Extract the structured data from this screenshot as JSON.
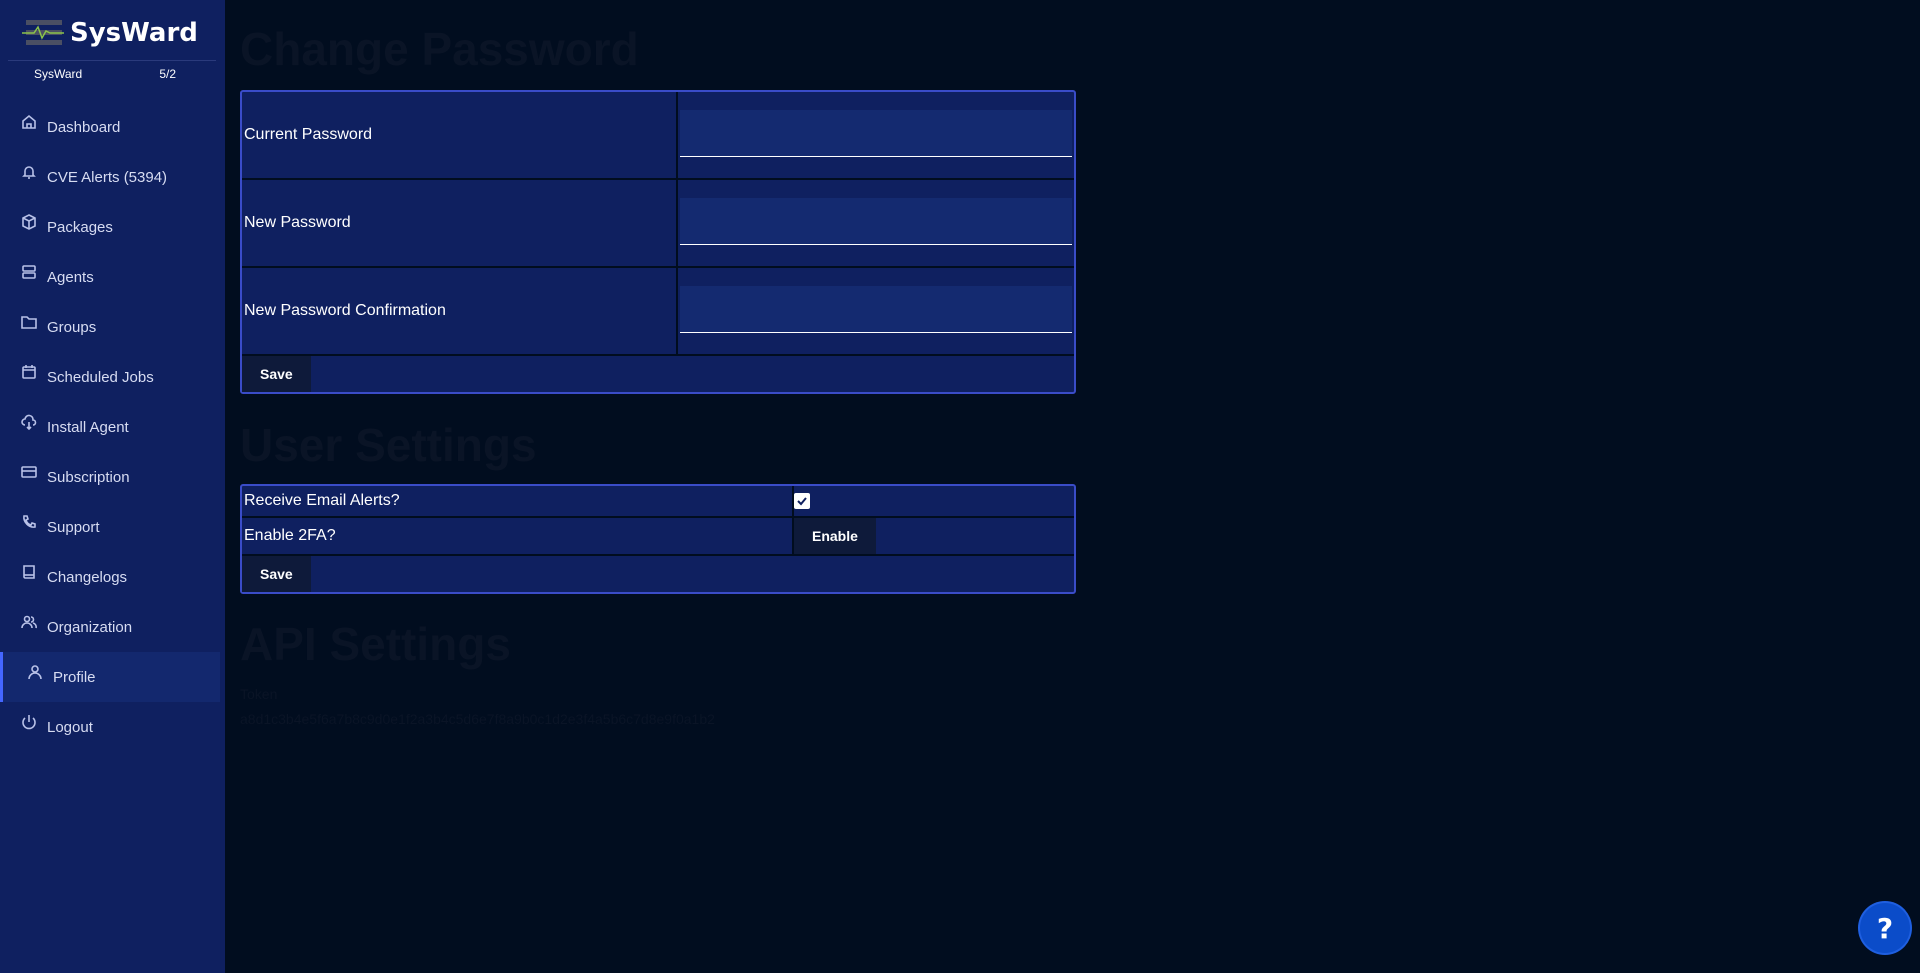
{
  "brand": {
    "name": "SysWard"
  },
  "org": {
    "name": "SysWard",
    "counter": "5/2"
  },
  "nav": [
    {
      "label": "Dashboard",
      "icon": "home-icon"
    },
    {
      "label": "CVE Alerts (5394)",
      "icon": "bell-icon"
    },
    {
      "label": "Packages",
      "icon": "box-icon"
    },
    {
      "label": "Agents",
      "icon": "server-icon"
    },
    {
      "label": "Groups",
      "icon": "folder-icon"
    },
    {
      "label": "Scheduled Jobs",
      "icon": "calendar-icon"
    },
    {
      "label": "Install Agent",
      "icon": "cloud-download-icon"
    },
    {
      "label": "Subscription",
      "icon": "credit-card-icon"
    },
    {
      "label": "Support",
      "icon": "phone-icon"
    },
    {
      "label": "Changelogs",
      "icon": "book-icon"
    },
    {
      "label": "Organization",
      "icon": "users-icon"
    },
    {
      "label": "Profile",
      "icon": "user-icon",
      "active": true
    },
    {
      "label": "Logout",
      "icon": "power-icon"
    }
  ],
  "change_password": {
    "title": "Change Password",
    "fields": [
      {
        "label": "Current Password",
        "value": ""
      },
      {
        "label": "New Password",
        "value": ""
      },
      {
        "label": "New Password Confirmation",
        "value": ""
      }
    ],
    "save_label": "Save"
  },
  "user_settings": {
    "title": "User Settings",
    "email_alerts_label": "Receive Email Alerts?",
    "email_alerts_checked": true,
    "twofa_label": "Enable 2FA?",
    "twofa_button": "Enable",
    "save_label": "Save"
  },
  "api_settings": {
    "title": "API Settings",
    "token_label": "Token",
    "token_value": "a8d1c3b4e5f6a7b8c9d0e1f2a3b4c5d6e7f8a9b0c1d2e3f4a5b6c7d8e9f0a1b2"
  },
  "help": {
    "label": "?"
  },
  "colors": {
    "sidebar": "#0f2060",
    "background": "#010d1f",
    "accent": "#3a4cc8",
    "help": "#0b4cc9"
  }
}
